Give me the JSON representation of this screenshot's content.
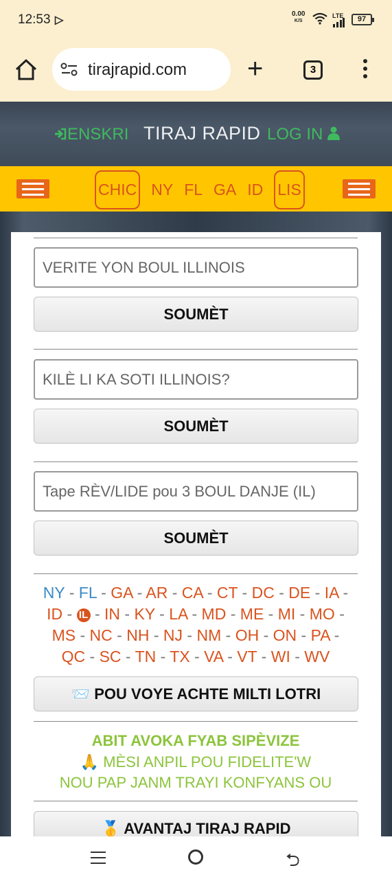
{
  "status": {
    "time": "12:53",
    "speed": "0.00",
    "speed_unit": "K/S",
    "network": "LTE",
    "battery": "97"
  },
  "browser": {
    "url": "tirajrapid.com",
    "tab_count": "3"
  },
  "header": {
    "register_label": "ENSKRI",
    "title": "TIRAJ RAPID",
    "login_label": "LOG IN"
  },
  "nav": {
    "items": [
      "CHIC",
      "NY",
      "FL",
      "GA",
      "ID",
      "LIS"
    ]
  },
  "forms": [
    {
      "placeholder": "VERITE YON BOUL ILLINOIS",
      "button": "SOUMÈT"
    },
    {
      "placeholder": "KILÈ LI KA SOTI ILLINOIS?",
      "button": "SOUMÈT"
    },
    {
      "placeholder": "Tape RÈV/LIDE pou 3 BOUL DANJE (IL)",
      "button": "SOUMÈT"
    }
  ],
  "states": {
    "line1": [
      "NY",
      "FL",
      "GA",
      "AR",
      "CA",
      "CT",
      "DC",
      "DE",
      "IA"
    ],
    "line2": [
      "ID",
      "IL",
      "IN",
      "KY",
      "LA",
      "MD",
      "ME",
      "MI",
      "MO"
    ],
    "line3": [
      "MS",
      "NC",
      "NH",
      "NJ",
      "NM",
      "OH",
      "ON",
      "PA"
    ],
    "line4": [
      "QC",
      "SC",
      "TN",
      "TX",
      "VA",
      "VT",
      "WI",
      "WV"
    ],
    "selected": "IL",
    "separator": "-"
  },
  "multi_lottery_button": "📨 POU VOYE ACHTE MILTI LOTRI",
  "messages": {
    "line1": "ABIT AVOKA FYAB SIPÈVIZE",
    "line2": "🙏 MÈSI ANPIL POU FIDELITE'W",
    "line3": "NOU PAP JANM TRAYI KONFYANS OU"
  },
  "advantage_button": "🥇 AVANTAJ TIRAJ RAPID",
  "colors": {
    "accent_orange": "#d9531e",
    "nav_yellow": "#ffc600",
    "green": "#3fba5e",
    "light_green": "#8cc43c",
    "link_blue": "#3b8ac4"
  }
}
